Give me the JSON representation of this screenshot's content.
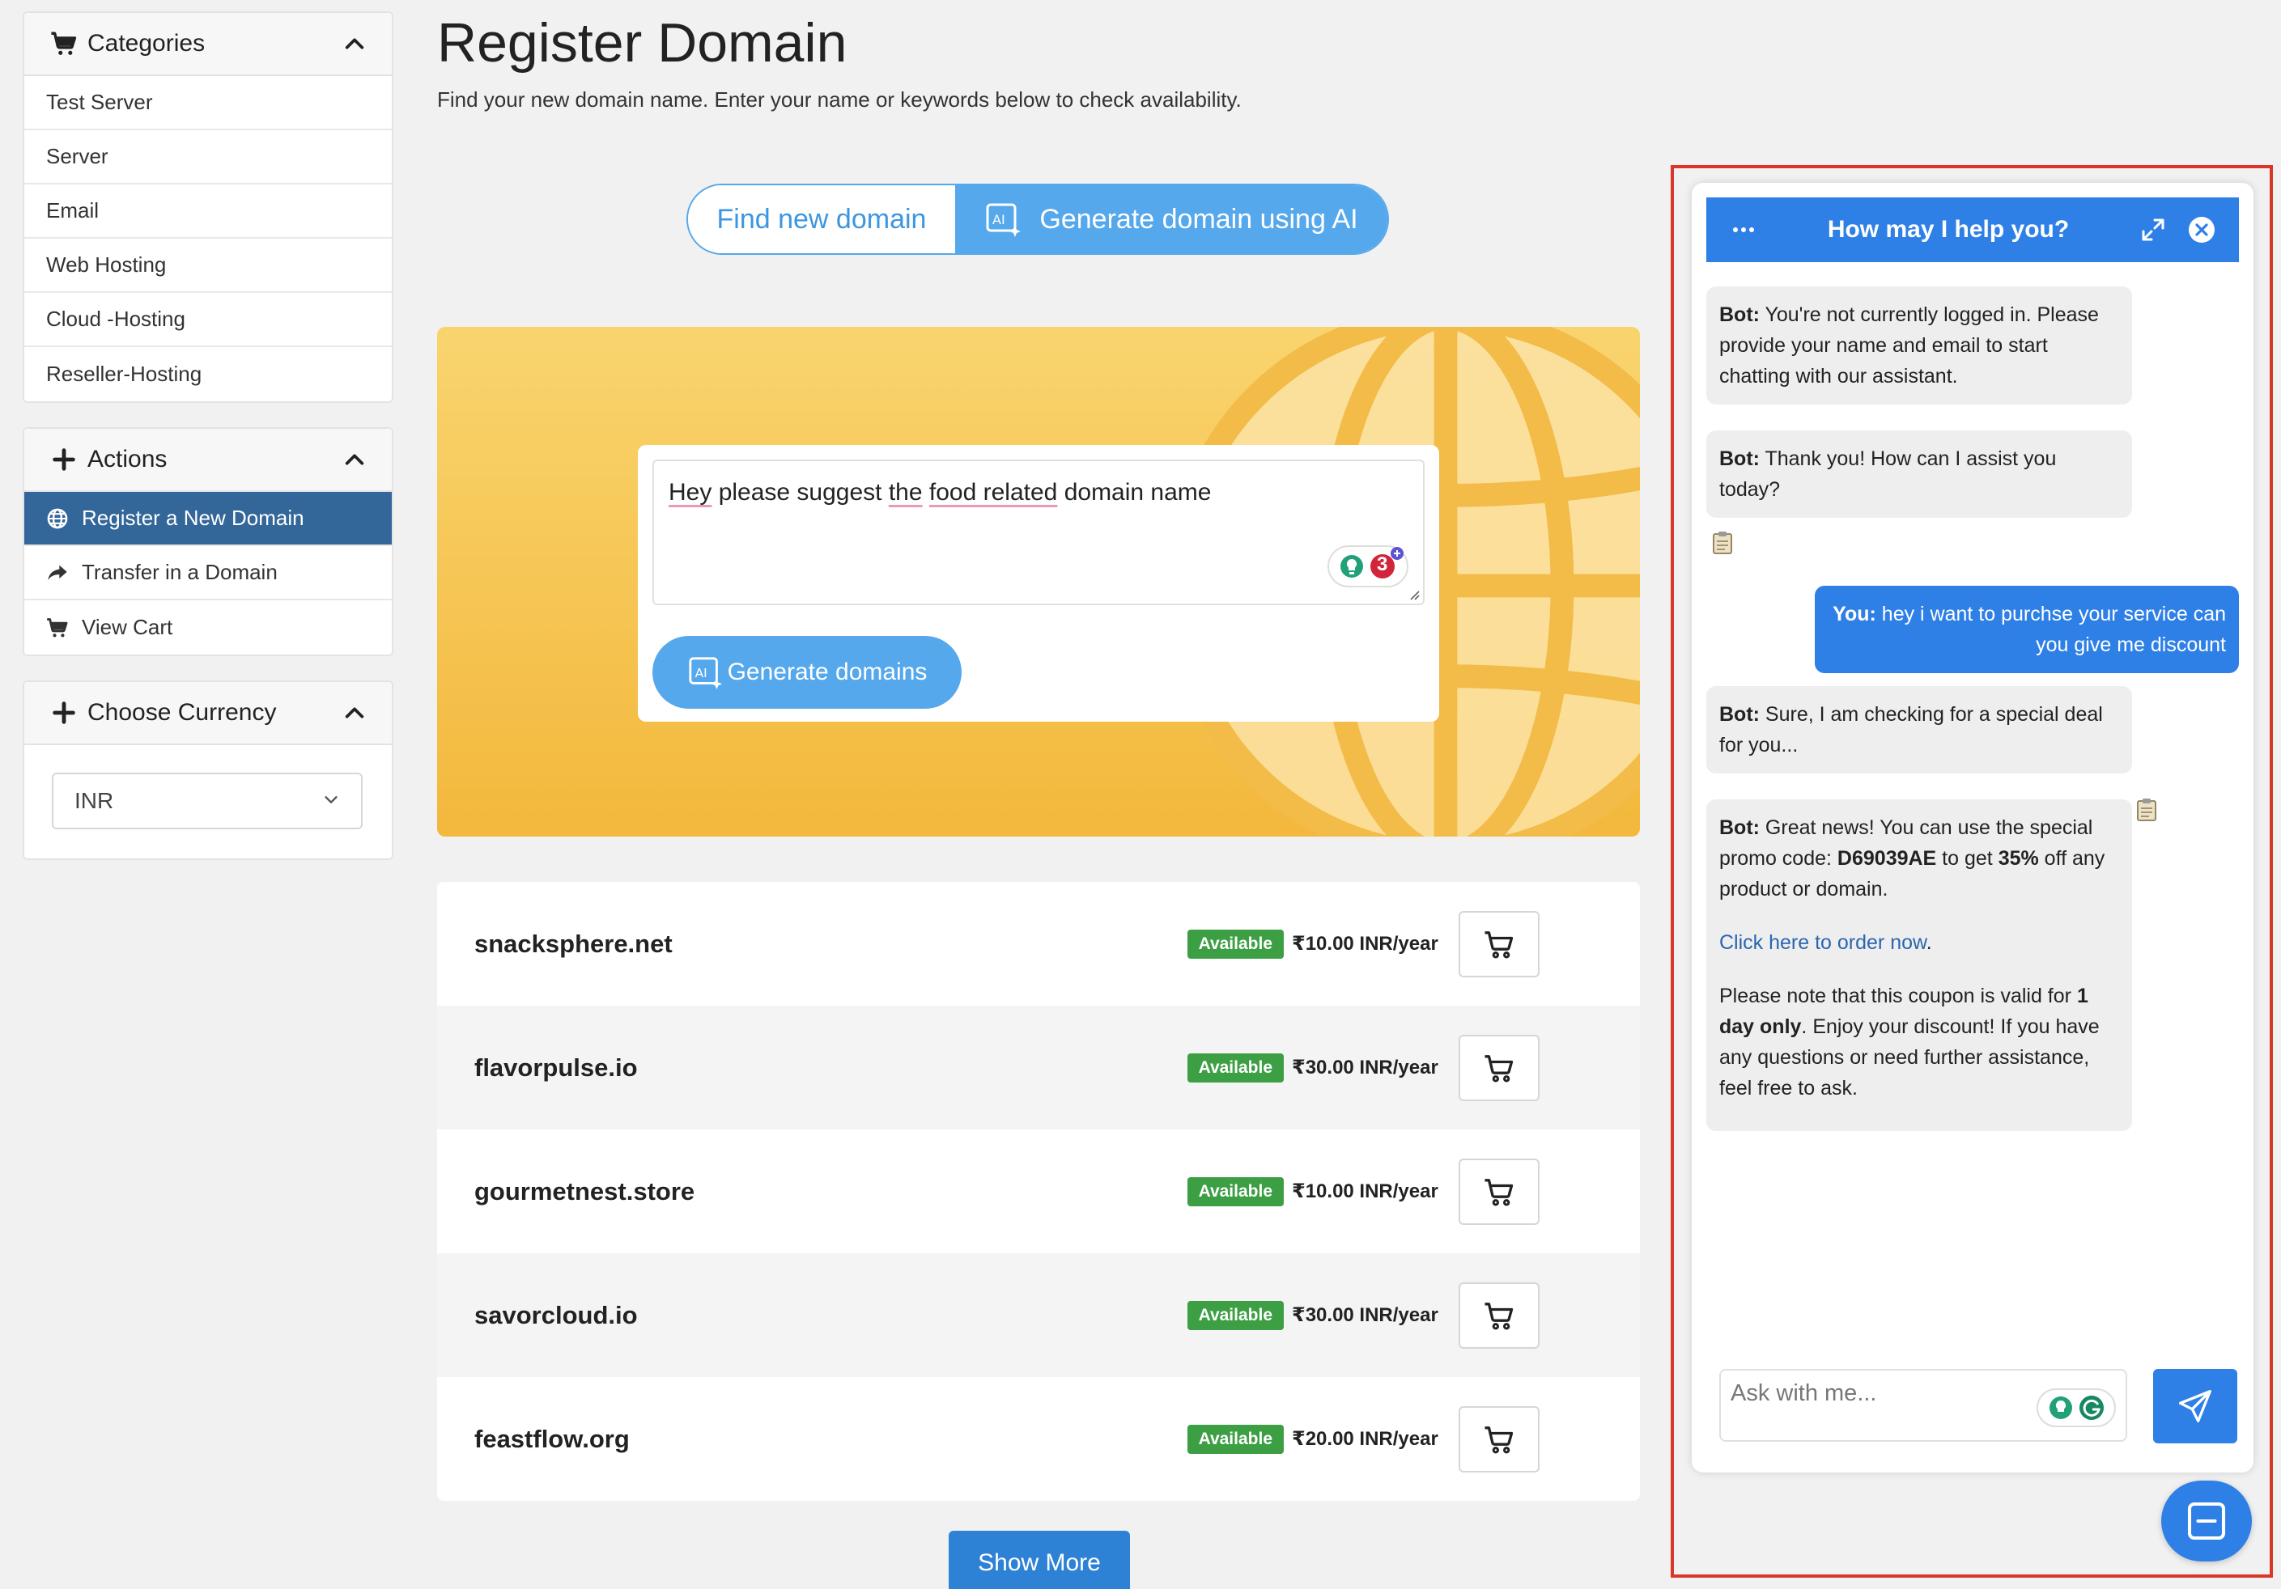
{
  "sidebar": {
    "categories": {
      "title": "Categories",
      "items": [
        "Test Server",
        "Server",
        "Email",
        "Web Hosting",
        "Cloud -Hosting",
        "Reseller-Hosting"
      ]
    },
    "actions": {
      "title": "Actions",
      "items": [
        "Register a New Domain",
        "Transfer in a Domain",
        "View Cart"
      ]
    },
    "currency": {
      "title": "Choose Currency",
      "selected": "INR"
    }
  },
  "main": {
    "title": "Register Domain",
    "subtitle": "Find your new domain name. Enter your name or keywords below to check availability.",
    "tabs": [
      "Find new domain",
      "Generate domain using AI"
    ],
    "prompt": {
      "w1": "Hey",
      "w2": " please suggest ",
      "w3": "the",
      "w4": " ",
      "w5": "food related",
      "w6": " domain name"
    },
    "ext_badge_count": "3",
    "generate_label": "Generate domains",
    "results": [
      {
        "domain": "snacksphere.net",
        "status": "Available",
        "price": "₹10.00 INR/year"
      },
      {
        "domain": "flavorpulse.io",
        "status": "Available",
        "price": "₹30.00 INR/year"
      },
      {
        "domain": "gourmetnest.store",
        "status": "Available",
        "price": "₹10.00 INR/year"
      },
      {
        "domain": "savorcloud.io",
        "status": "Available",
        "price": "₹30.00 INR/year"
      },
      {
        "domain": "feastflow.org",
        "status": "Available",
        "price": "₹20.00 INR/year"
      }
    ],
    "show_more": "Show More"
  },
  "chat": {
    "header_title": "How may I help you?",
    "messages": {
      "m1": {
        "who": "Bot:",
        "text": " You're not currently logged in. Please provide your name and email to start chatting with our assistant."
      },
      "m2": {
        "who": "Bot:",
        "text": " Thank you! How can I assist you today?"
      },
      "m3": {
        "who": "You:",
        "text": " hey i want to purchse your service can you give me discount"
      },
      "m4": {
        "who": "Bot:",
        "text": " Sure, I am checking for a special deal for you..."
      },
      "m5": {
        "who": "Bot:",
        "t1": " Great news! You can use the special promo code: ",
        "code": "D69039AE",
        "t2": " to get ",
        "pct": "35%",
        "t3": " off any product or domain.",
        "link": "Click here to order now",
        "t4": ".",
        "t5": "Please note that this coupon is valid for ",
        "dur": "1 day only",
        "t6": ". Enjoy your discount! If you have any questions or need further assistance, feel free to ask."
      }
    },
    "input_placeholder": "Ask with me..."
  },
  "colors": {
    "primary": "#2f80e6",
    "sidebar_active": "#336699",
    "available": "#3c9f44",
    "hero_top": "#f9d46e",
    "hero_bottom": "#f3b83c",
    "highlight_frame": "#d8382b"
  }
}
